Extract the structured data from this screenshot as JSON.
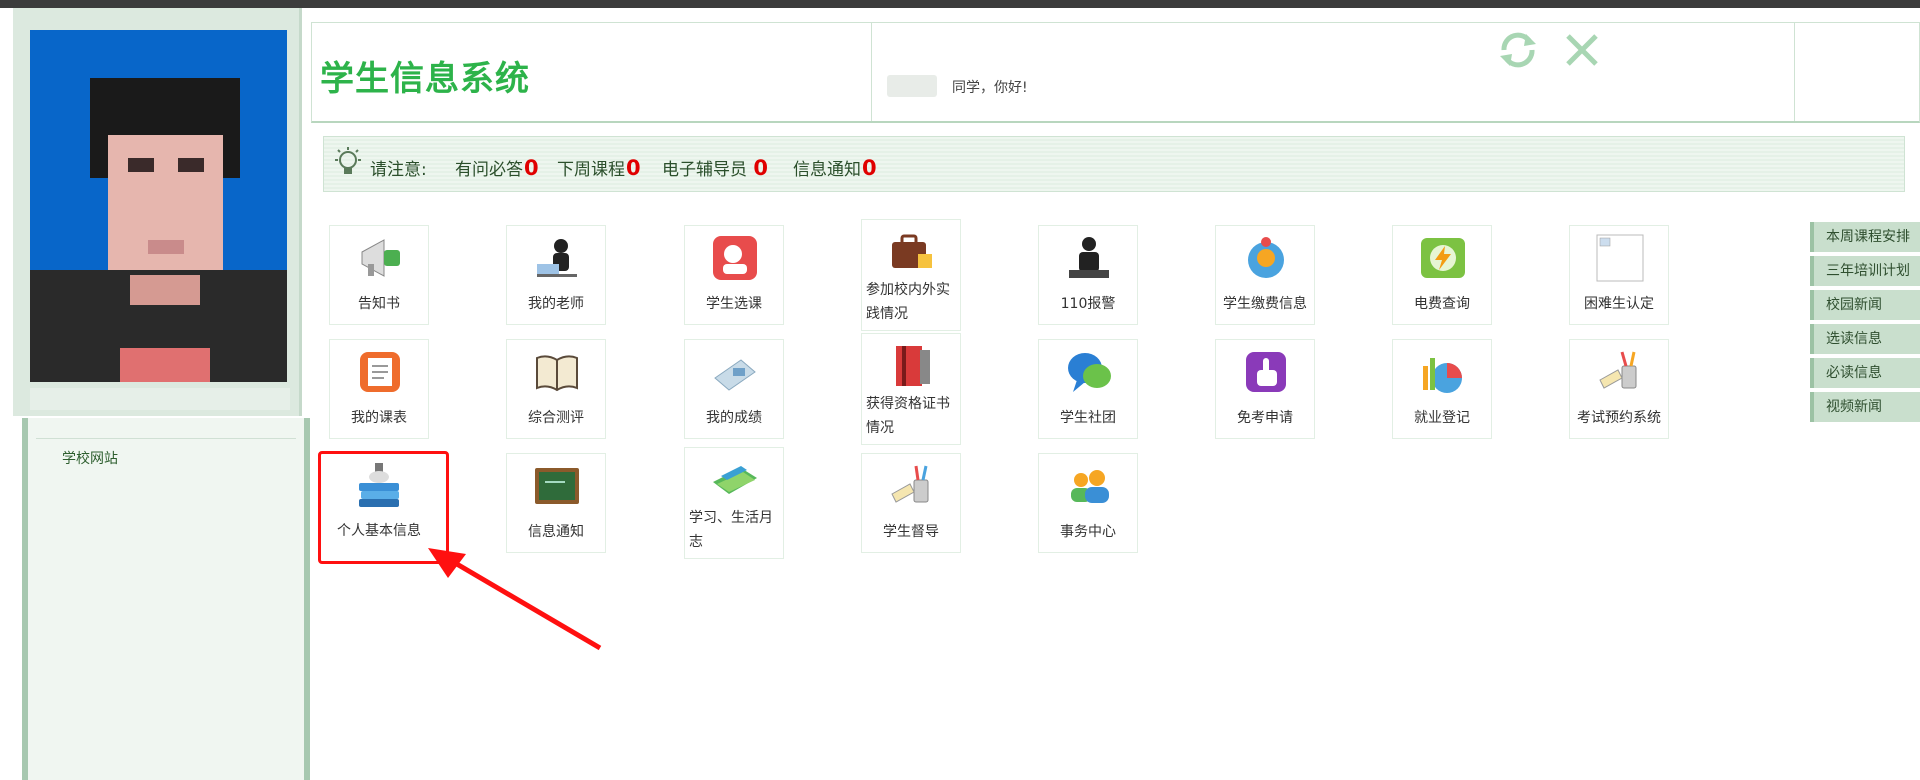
{
  "header": {
    "title": "学生信息系统",
    "greeting": "同学，你好!"
  },
  "sidebar": {
    "links": [
      {
        "label": "学校网站"
      }
    ]
  },
  "notice": {
    "label": "请注意:",
    "items": [
      {
        "label": "有问必答",
        "count": "0"
      },
      {
        "label": "下周课程",
        "count": "0"
      },
      {
        "label": "电子辅导员",
        "count": "0"
      },
      {
        "label": "信息通知",
        "count": "0"
      }
    ]
  },
  "tiles": [
    {
      "label": "告知书",
      "icon": "megaphone-icon"
    },
    {
      "label": "我的老师",
      "icon": "teacher-icon"
    },
    {
      "label": "学生选课",
      "icon": "course-select-icon"
    },
    {
      "label": "参加校内外实践情况",
      "icon": "briefcase-icon"
    },
    {
      "label": "110报警",
      "icon": "police-icon"
    },
    {
      "label": "学生缴费信息",
      "icon": "payment-icon"
    },
    {
      "label": "电费查询",
      "icon": "electricity-icon"
    },
    {
      "label": "困难生认定",
      "icon": "broken-image-icon"
    },
    {
      "label": "我的课表",
      "icon": "schedule-icon"
    },
    {
      "label": "综合测评",
      "icon": "book-icon"
    },
    {
      "label": "我的成绩",
      "icon": "grades-icon"
    },
    {
      "label": "获得资格证书情况",
      "icon": "certificate-icon"
    },
    {
      "label": "学生社团",
      "icon": "chat-bubbles-icon"
    },
    {
      "label": "免考申请",
      "icon": "hand-pointer-icon"
    },
    {
      "label": "就业登记",
      "icon": "pie-chart-icon"
    },
    {
      "label": "考试预约系统",
      "icon": "pencil-cup-icon"
    },
    {
      "label": "个人基本信息",
      "icon": "books-stack-icon"
    },
    {
      "label": "信息通知",
      "icon": "chalkboard-icon"
    },
    {
      "label": "学习、生活月志",
      "icon": "notebooks-icon"
    },
    {
      "label": "学生督导",
      "icon": "supervision-icon"
    },
    {
      "label": "事务中心",
      "icon": "people-icon"
    }
  ],
  "right_menu": [
    {
      "label": "本周课程安排"
    },
    {
      "label": "三年培训计划"
    },
    {
      "label": "校园新闻"
    },
    {
      "label": "选读信息"
    },
    {
      "label": "必读信息"
    },
    {
      "label": "视频新闻"
    }
  ],
  "colors": {
    "title_green": "#2db34a",
    "count_red": "#e00000",
    "highlight_red": "#ff1010",
    "menu_bg": "#c9dfcd"
  }
}
